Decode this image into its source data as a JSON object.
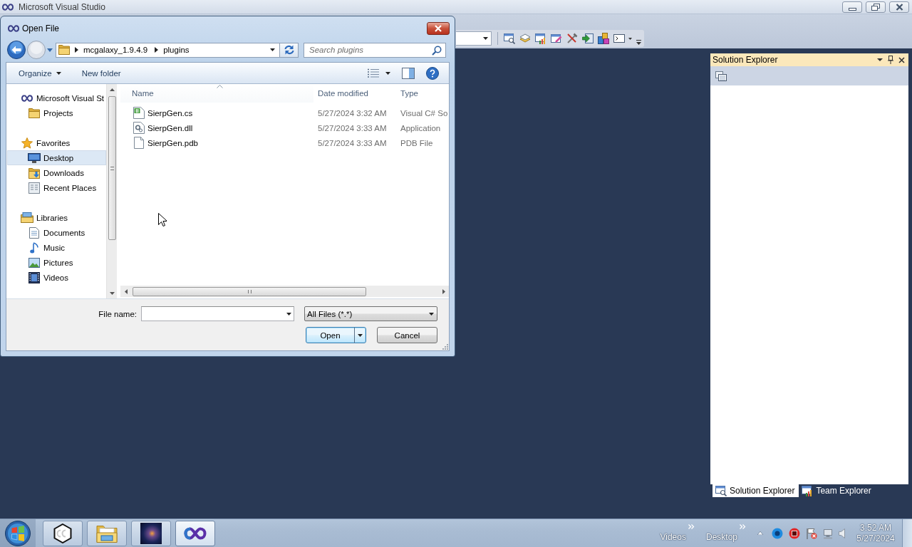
{
  "window": {
    "title": "Microsoft Visual Studio"
  },
  "dialog": {
    "title": "Open File",
    "path": [
      "mcgalaxy_1.9.4.9",
      "plugins"
    ],
    "search": {
      "placeholder": "Search plugins"
    },
    "commands": [
      {
        "label": "Organize",
        "kind": "menu"
      },
      {
        "label": "New folder",
        "kind": "plain"
      }
    ],
    "navigation": [
      {
        "label": "Microsoft Visual St",
        "kind": "app",
        "selected": false,
        "children": [
          {
            "label": "Projects",
            "kind": "folder",
            "selected": false
          }
        ]
      },
      {
        "label": "Favorites",
        "kind": "star",
        "selected": false,
        "children": [
          {
            "label": "Desktop",
            "kind": "desktop",
            "selected": true
          },
          {
            "label": "Downloads",
            "kind": "downloads",
            "selected": false
          },
          {
            "label": "Recent Places",
            "kind": "recent",
            "selected": false
          }
        ]
      },
      {
        "label": "Libraries",
        "kind": "library",
        "selected": false,
        "children": [
          {
            "label": "Documents",
            "kind": "document",
            "selected": false
          },
          {
            "label": "Music",
            "kind": "music",
            "selected": false
          },
          {
            "label": "Pictures",
            "kind": "picture",
            "selected": false
          },
          {
            "label": "Videos",
            "kind": "video",
            "selected": false
          }
        ]
      }
    ],
    "columns": [
      {
        "label": "Name",
        "sorted": true
      },
      {
        "label": "Date modified",
        "sorted": false
      },
      {
        "label": "Type",
        "sorted": false
      }
    ],
    "files": [
      {
        "name": "SierpGen.cs",
        "kind": "csharp",
        "date_modified": "5/27/2024 3:32 AM",
        "type": "Visual C# So"
      },
      {
        "name": "SierpGen.dll",
        "kind": "dll",
        "date_modified": "5/27/2024 3:33 AM",
        "type": "Application"
      },
      {
        "name": "SierpGen.pdb",
        "kind": "blank",
        "date_modified": "5/27/2024 3:33 AM",
        "type": "PDB File"
      }
    ],
    "file_name": {
      "label": "File name:"
    },
    "file_type": {
      "value": "All Files (*.*)"
    },
    "buttons": [
      {
        "label": "Open",
        "kind": "split",
        "default": true
      },
      {
        "label": "Cancel",
        "kind": "plain",
        "default": false
      }
    ]
  },
  "solution_explorer": {
    "title": "Solution Explorer",
    "tabs": [
      {
        "label": "Solution Explorer",
        "kind": "solution",
        "selected": true
      },
      {
        "label": "Team Explorer",
        "kind": "team",
        "selected": false
      }
    ]
  },
  "taskbar": {
    "apps": [
      {
        "kind": "cube",
        "active": false
      },
      {
        "kind": "explorer",
        "active": false
      },
      {
        "kind": "photo",
        "active": false
      },
      {
        "kind": "studio",
        "active": true
      }
    ],
    "toolbars": [
      "Videos",
      "Desktop"
    ],
    "clock": {
      "time": "3:52 AM",
      "date": "5/27/2024"
    }
  }
}
